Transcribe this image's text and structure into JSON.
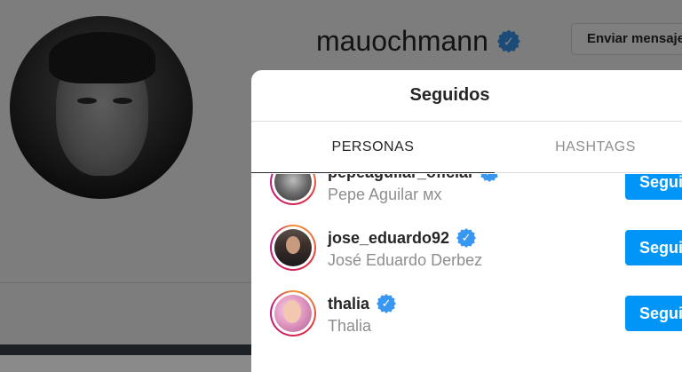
{
  "profile": {
    "username": "mauochmann",
    "message_button": "Enviar mensaje"
  },
  "modal": {
    "title": "Seguidos",
    "tabs": [
      {
        "label": "PERSONAS",
        "active": true
      },
      {
        "label": "HASHTAGS",
        "active": false
      }
    ],
    "accounts": [
      {
        "username": "pepeaguilar_oficial",
        "full_name": "Pepe Aguilar мх",
        "verified": true,
        "follow_label": "Seguir"
      },
      {
        "username": "jose_eduardo92",
        "full_name": "José Eduardo Derbez",
        "verified": true,
        "follow_label": "Seguir"
      },
      {
        "username": "thalia",
        "full_name": "Thalia",
        "verified": true,
        "follow_label": "Seguir"
      }
    ]
  },
  "icons": {
    "verified": "verified-badge-icon",
    "verified_mark": "✓"
  },
  "colors": {
    "accent": "#0095f6",
    "verified": "#3897f0",
    "primary_text": "#262626",
    "secondary_text": "#8e8e8e"
  }
}
